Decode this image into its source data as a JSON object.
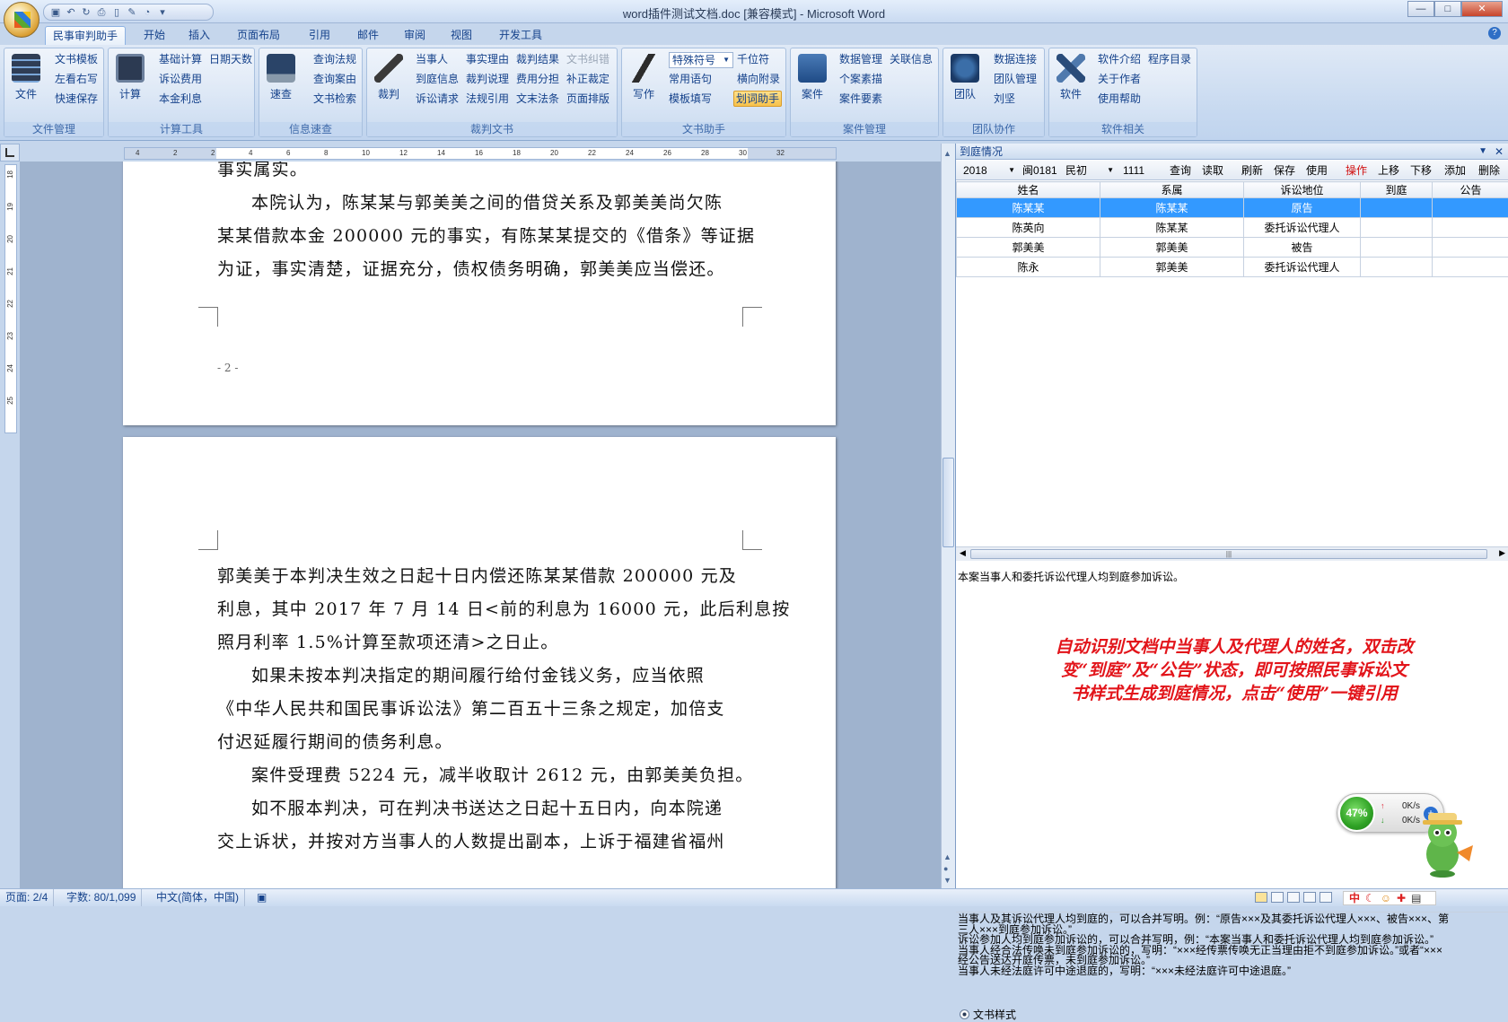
{
  "window": {
    "title": "word插件测试文档.doc [兼容模式] - Microsoft Word",
    "controls": {
      "minimize": "—",
      "maximize": "□",
      "close": "✕"
    }
  },
  "tabs": [
    "民事审判助手",
    "开始",
    "插入",
    "页面布局",
    "引用",
    "邮件",
    "审阅",
    "视图",
    "开发工具"
  ],
  "ribbon": {
    "file_mgmt": {
      "label": "文件管理",
      "big": "文件",
      "items": [
        "文书模板",
        "左看右写",
        "快速保存"
      ]
    },
    "calc": {
      "label": "计算工具",
      "big": "计算",
      "items": [
        "基础计算",
        "日期天数",
        "诉讼费用",
        "本金利息"
      ]
    },
    "info": {
      "label": "信息速查",
      "big": "速查",
      "items": [
        "查询法规",
        "查询案由",
        "文书检索"
      ]
    },
    "judge": {
      "label": "裁判文书",
      "big": "裁判",
      "items": [
        "当事人",
        "事实理由",
        "裁判结果",
        "文书纠错",
        "到庭信息",
        "裁判说理",
        "费用分担",
        "补正裁定",
        "诉讼请求",
        "法规引用",
        "文末法条",
        "页面排版"
      ]
    },
    "write": {
      "label": "文书助手",
      "big": "写作",
      "dropdown": "特殊符号",
      "items": [
        "千位符",
        "常用语句",
        "横向附录",
        "模板填写",
        "划词助手"
      ]
    },
    "case": {
      "label": "案件管理",
      "big": "案件",
      "items": [
        "数据管理",
        "关联信息",
        "个案素描",
        "案件要素"
      ]
    },
    "team": {
      "label": "团队协作",
      "big": "团队",
      "items": [
        "数据连接",
        "团队管理",
        "刘坚"
      ]
    },
    "soft": {
      "label": "软件相关",
      "big": "软件",
      "items": [
        "软件介绍",
        "程序目录",
        "关于作者",
        "使用帮助"
      ]
    }
  },
  "document": {
    "page1_lines": [
      "事实属实。",
      "本院认为，陈某某与郭美美之间的借贷关系及郭美美尚欠陈",
      "某某借款本金 200000 元的事实，有陈某某提交的《借条》等证据",
      "为证，事实清楚，证据充分，债权债务明确，郭美美应当偿还。"
    ],
    "page_number": "- 2 -",
    "page2_lines": [
      "郭美美于本判决生效之日起十日内偿还陈某某借款  200000  元及",
      "利息，其中 2017 年 7 月 14 日<前的利息为 16000 元，此后利息按",
      "照月利率 1.5%计算至款项还清>之日止。",
      "如果未按本判决指定的期间履行给付金钱义务，应当依照",
      "《中华人民共和国民事诉讼法》第二百五十三条之规定，加倍支",
      "付迟延履行期间的债务利息。",
      "案件受理费 5224 元，减半收取计 2612 元，由郭美美负担。",
      "如不服本判决，可在判决书送达之日起十五日内，向本院递",
      "交上诉状，并按对方当事人的人数提出副本，上诉于福建省福州"
    ]
  },
  "ruler_ticks": [
    "4",
    "2",
    "2",
    "4",
    "6",
    "8",
    "10",
    "12",
    "14",
    "16",
    "18",
    "20",
    "22",
    "24",
    "26",
    "28",
    "30",
    "32"
  ],
  "vruler_ticks": [
    "18",
    "19",
    "20",
    "21",
    "22",
    "23",
    "24",
    "25"
  ],
  "panel": {
    "title": "到庭情况",
    "toolbar": {
      "year": "2018",
      "court": "闽0181",
      "type": "民初",
      "number": "1111",
      "buttons": [
        "查询",
        "读取",
        "刷新",
        "保存",
        "使用",
        "操作",
        "上移",
        "下移",
        "添加",
        "删除"
      ]
    },
    "columns": [
      "姓名",
      "系属",
      "诉讼地位",
      "到庭",
      "公告"
    ],
    "rows": [
      [
        "陈某某",
        "陈某某",
        "原告",
        "",
        ""
      ],
      [
        "陈英向",
        "陈某某",
        "委托诉讼代理人",
        "",
        ""
      ],
      [
        "郭美美",
        "郭美美",
        "被告",
        "",
        ""
      ],
      [
        "陈永",
        "郭美美",
        "委托诉讼代理人",
        "",
        ""
      ]
    ],
    "result_text": "本案当事人和委托诉讼代理人均到庭参加诉讼。",
    "annotation": "自动识别文档中当事人及代理人的姓名，双击改变“到庭”及“公告”状态，即可按照民事诉讼文书样式生成到庭情况，点击“使用”一键引用",
    "notes": [
      "当事人及其诉讼代理人均到庭的，可以合并写明。例：“原告×××及其委托诉讼代理人×××、被告×××、第",
      "三人×××到庭参加诉讼。”",
      "诉讼参加人均到庭参加诉讼的，可以合并写明，例：“本案当事人和委托诉讼代理人均到庭参加诉讼。”",
      "当事人经合法传唤未到庭参加诉讼的，写明：“×××经传票传唤无正当理由拒不到庭参加诉讼。”或者“×××",
      "经公告送达开庭传票，未到庭参加诉讼。”",
      "当事人未经法庭许可中途退庭的，写明：“×××未经法庭许可中途退庭。”"
    ],
    "radio_label": "文书样式"
  },
  "net_widget": {
    "percent": "47%",
    "up": "0K/s",
    "down": "0K/s"
  },
  "statusbar": {
    "page": "页面: 2/4",
    "words": "字数: 80/1,099",
    "lang": "中文(简体，中国)"
  }
}
